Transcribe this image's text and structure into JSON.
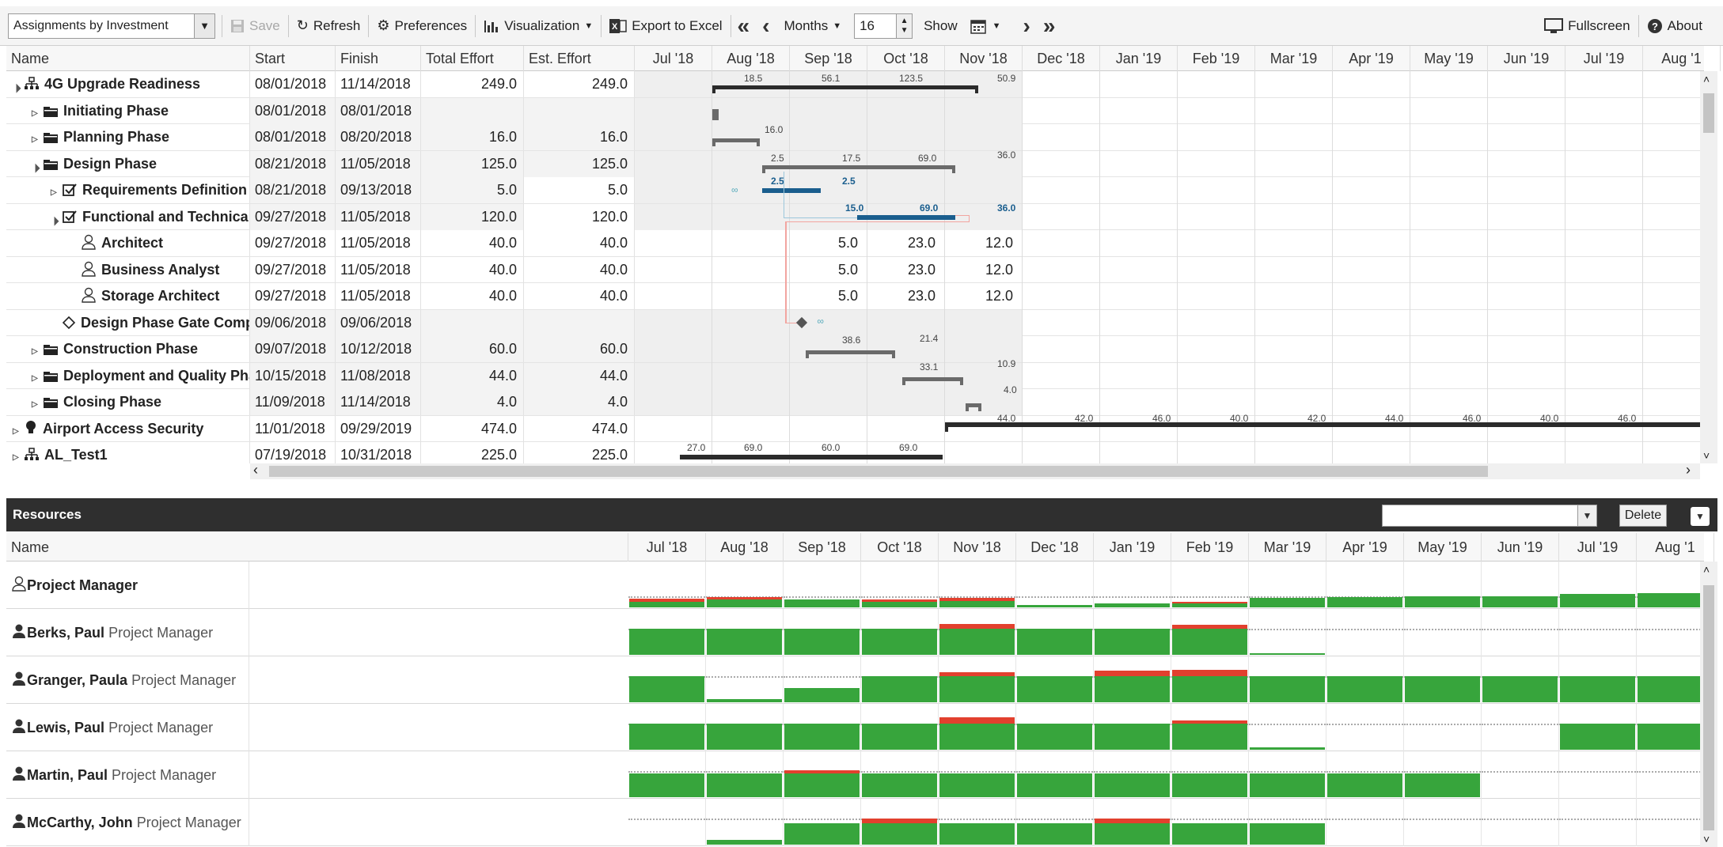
{
  "toolbar": {
    "view_select": "Assignments by Investment",
    "save": "Save",
    "refresh": "Refresh",
    "preferences": "Preferences",
    "visualization": "Visualization",
    "export": "Export to Excel",
    "scale": "Months",
    "periods": "16",
    "show": "Show",
    "fullscreen": "Fullscreen",
    "about": "About"
  },
  "grid": {
    "columns": {
      "name": "Name",
      "start": "Start",
      "finish": "Finish",
      "total_effort": "Total Effort",
      "est_effort": "Est. Effort"
    },
    "months": [
      "Jul '18",
      "Aug '18",
      "Sep '18",
      "Oct '18",
      "Nov '18",
      "Dec '18",
      "Jan '19",
      "Feb '19",
      "Mar '19",
      "Apr '19",
      "May '19",
      "Jun '19",
      "Jul '19",
      "Aug '1"
    ],
    "rows": [
      {
        "name": "4G Upgrade Readiness",
        "start": "08/01/2018",
        "finish": "11/14/2018",
        "total": "249.0",
        "est": "249.0",
        "icon": "hierarchy-icon"
      },
      {
        "name": "Initiating Phase",
        "start": "08/01/2018",
        "finish": "08/01/2018",
        "total": "",
        "est": "",
        "icon": "folder-icon"
      },
      {
        "name": "Planning Phase",
        "start": "08/01/2018",
        "finish": "08/20/2018",
        "total": "16.0",
        "est": "16.0",
        "icon": "folder-icon"
      },
      {
        "name": "Design Phase",
        "start": "08/21/2018",
        "finish": "11/05/2018",
        "total": "125.0",
        "est": "125.0",
        "icon": "folder-icon"
      },
      {
        "name": "Requirements Definition",
        "start": "08/21/2018",
        "finish": "09/13/2018",
        "total": "5.0",
        "est": "5.0",
        "icon": "task-check-icon"
      },
      {
        "name": "Functional and Technica",
        "start": "09/27/2018",
        "finish": "11/05/2018",
        "total": "120.0",
        "est": "120.0",
        "icon": "task-check-icon"
      },
      {
        "name": "Architect",
        "start": "09/27/2018",
        "finish": "11/05/2018",
        "total": "40.0",
        "est": "40.0",
        "icon": "person-outline-icon",
        "alloc": [
          "5.0",
          "23.0",
          "12.0"
        ]
      },
      {
        "name": "Business Analyst",
        "start": "09/27/2018",
        "finish": "11/05/2018",
        "total": "40.0",
        "est": "40.0",
        "icon": "person-outline-icon",
        "alloc": [
          "5.0",
          "23.0",
          "12.0"
        ]
      },
      {
        "name": "Storage Architect",
        "start": "09/27/2018",
        "finish": "11/05/2018",
        "total": "40.0",
        "est": "40.0",
        "icon": "person-outline-icon",
        "alloc": [
          "5.0",
          "23.0",
          "12.0"
        ]
      },
      {
        "name": "Design Phase Gate Comp",
        "start": "09/06/2018",
        "finish": "09/06/2018",
        "total": "",
        "est": "",
        "icon": "milestone-icon"
      },
      {
        "name": "Construction Phase",
        "start": "09/07/2018",
        "finish": "10/12/2018",
        "total": "60.0",
        "est": "60.0",
        "icon": "folder-icon"
      },
      {
        "name": "Deployment and Quality Pha",
        "start": "10/15/2018",
        "finish": "11/08/2018",
        "total": "44.0",
        "est": "44.0",
        "icon": "folder-icon"
      },
      {
        "name": "Closing Phase",
        "start": "11/09/2018",
        "finish": "11/14/2018",
        "total": "4.0",
        "est": "4.0",
        "icon": "folder-icon"
      },
      {
        "name": "Airport Access Security",
        "start": "11/01/2018",
        "finish": "09/29/2019",
        "total": "474.0",
        "est": "474.0",
        "icon": "lightbulb-icon"
      },
      {
        "name": "AL_Test1",
        "start": "07/19/2018",
        "finish": "10/31/2018",
        "total": "225.0",
        "est": "225.0",
        "icon": "hierarchy-icon"
      }
    ]
  },
  "gantt_labels": {
    "r0": [
      "18.5",
      "56.1",
      "123.5",
      "50.9"
    ],
    "r2": [
      "16.0"
    ],
    "r3": [
      "2.5",
      "17.5",
      "69.0",
      "36.0"
    ],
    "r4": [
      "2.5",
      "2.5"
    ],
    "r5": [
      "15.0",
      "69.0",
      "36.0"
    ],
    "r10": [
      "38.6",
      "21.4"
    ],
    "r11": [
      "33.1",
      "10.9"
    ],
    "r12": [
      "4.0"
    ],
    "r13": [
      "44.0",
      "42.0",
      "46.0",
      "40.0",
      "42.0",
      "44.0",
      "46.0",
      "40.0",
      "46.0"
    ],
    "r14": [
      "27.0",
      "69.0",
      "60.0",
      "69.0"
    ]
  },
  "resources": {
    "title": "Resources",
    "delete": "Delete",
    "col_name": "Name",
    "rows": [
      {
        "name": "Project Manager",
        "role": "",
        "icon": "person-outline-icon"
      },
      {
        "name": "Berks, Paul",
        "role": "Project Manager",
        "icon": "person-icon"
      },
      {
        "name": "Granger, Paula",
        "role": "Project Manager",
        "icon": "person-icon"
      },
      {
        "name": "Lewis, Paul",
        "role": "Project Manager",
        "icon": "person-icon"
      },
      {
        "name": "Martin, Paul",
        "role": "Project Manager",
        "icon": "person-icon"
      },
      {
        "name": "McCarthy, John",
        "role": "Project Manager",
        "icon": "person-icon"
      }
    ]
  },
  "colors": {
    "allocated": "#37a53c",
    "overallocated": "#e2402e",
    "bar": "#2b2b2b",
    "selected_bar": "#1a5e8e"
  }
}
